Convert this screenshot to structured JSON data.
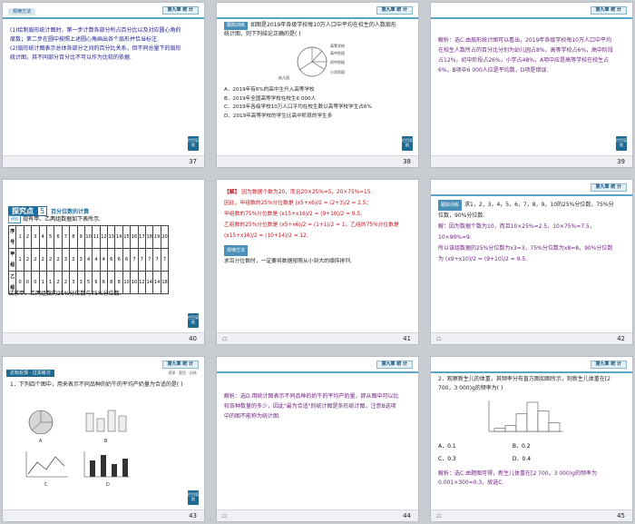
{
  "header_label": "第九章 统 计",
  "nav_label": "栏目导航",
  "slides": [
    {
      "num": "37",
      "lines": [
        "(1)绘制扇形统计图时，第一步计算各部分所占百分比以及对应圆心角的度数；第二步在圆中按照上述圆心角画出各个扇形并恰当标注.",
        "(2)扇形统计图表示总体各部分之间的百分比关系，但不同总量下的扇形统计图，其不同部分百分比不可以作为比较的依据."
      ]
    },
    {
      "num": "38",
      "tag": "跟踪训练",
      "question": "如图是2019年各级学校每10万人口中平均在校生的人数扇形统计图，则下列结论正确的是(      )",
      "pie_labels": [
        "高等学校",
        "高中阶段",
        "初中阶段",
        "小学阶段",
        "幼儿园"
      ],
      "options": [
        "A．2019年有6%的高中生升入高等学校",
        "B．2019年全国高等学校在校生6 000人",
        "C．2019年各级学校10万人口平均在校生数以高等学校学生占6%",
        "D．2019年高等学校的学生比高中阶段的学生多"
      ]
    },
    {
      "num": "39",
      "answer": "解析：选C.由扇形统计图可以看出，2019年各级学校每10万人口中平均在校生人数所占的百分比分别为幼儿园占8%，高等学校占6%，高中阶段占12%，初中阶段占26%，小学占48%，A项中应是高等学校在校生占6%，B项中6 000人应是平均数，D项是错误.",
      "answer_lead": "解析：选C."
    },
    {
      "num": "40",
      "sect_num": "5",
      "sect_title": "百分位数的计算",
      "example_tag": "例6",
      "example_text": "现有甲、乙两组数据如下表所示.",
      "table": {
        "head": [
          "序号",
          "1",
          "2",
          "3",
          "4",
          "5",
          "6",
          "7",
          "8",
          "9",
          "10",
          "11",
          "12",
          "13",
          "14",
          "15",
          "16",
          "17",
          "18",
          "19",
          "20"
        ],
        "row1_label": "甲组",
        "row1": [
          "1",
          "2",
          "2",
          "2",
          "2",
          "2",
          "3",
          "3",
          "3",
          "4",
          "4",
          "4",
          "6",
          "6",
          "6",
          "7",
          "7",
          "7",
          "7",
          "7"
        ],
        "row2_label": "乙组",
        "row2": [
          "0",
          "0",
          "0",
          "1",
          "1",
          "2",
          "2",
          "3",
          "3",
          "5",
          "6",
          "6",
          "8",
          "8",
          "10",
          "10",
          "12",
          "14",
          "14",
          "18"
        ]
      },
      "question": "试求甲、乙两组数的25%分位数与75%分位数."
    },
    {
      "num": "41",
      "sol_tag": "【解】",
      "lines": [
        "因为数据个数为20，而且20×25%=5，20×75%=15.",
        "因此，甲组数的25%分位数是 (x5+x6)/2 = (2+3)/2 = 2.5；",
        "甲组数的75%分位数是 (x15+x16)/2 = (9+10)/2 = 9.5.",
        "乙组数的25%分位数是 (x5+x6)/2 = (1+1)/2 = 1，乙组的75%分位数是 (x15+x16)/2 = (10+14)/2 = 12."
      ],
      "method_tag": "规律方法",
      "method": "求百分位数时，一定要将数据按照从小到大的顺序排列."
    },
    {
      "num": "42",
      "tag": "跟踪训练",
      "question": "求1，2，3，4，5，6，7，8，9，10的25%分位数，75%分位数，90%分位数.",
      "answer_lines": [
        "解：因为数据个数为10，而且10×25%=2.5，10×75%=7.5，10×90%=9.",
        "所以该组数据的25%分位数为x3=3，75%分位数为x8=8，90%分位数为 (x9+x10)/2 = (9+10)/2 = 9.5."
      ]
    },
    {
      "num": "43",
      "banner": "达标反馈 · 过关练习",
      "banner_sub": "规律 · 题型 · 训练",
      "question": "1．下列四个图中，用来表示不同品种的奶牛的平均产奶量为合适的是(      )",
      "fig_labels": [
        "A",
        "B",
        "C",
        "D"
      ]
    },
    {
      "num": "44",
      "answer": "解析：选D.用统计图表示不同品种的奶牛的平均产奶量，即从图中可以比较各种数量的多少，因此\"最为合适\"的统计图是条形统计图，注意B选项中的图不能称为统计图."
    },
    {
      "num": "45",
      "question": "2．观察新生儿的体重，其频率分布直方图如图所示，则新生儿体重在[2 700，3 000)g的频率为(      )",
      "options": [
        "A．0.1",
        "B．0.2",
        "C．0.3",
        "D．0.4"
      ],
      "answer": "解析：选C.由题图可得，新生儿体重在[2 700，3 000)g的频率为0.001×300=0.3，故选C.",
      "hist_values": [
        0.0001,
        0.0002,
        0.0006,
        0.001,
        0.0007,
        0.0003
      ]
    }
  ]
}
